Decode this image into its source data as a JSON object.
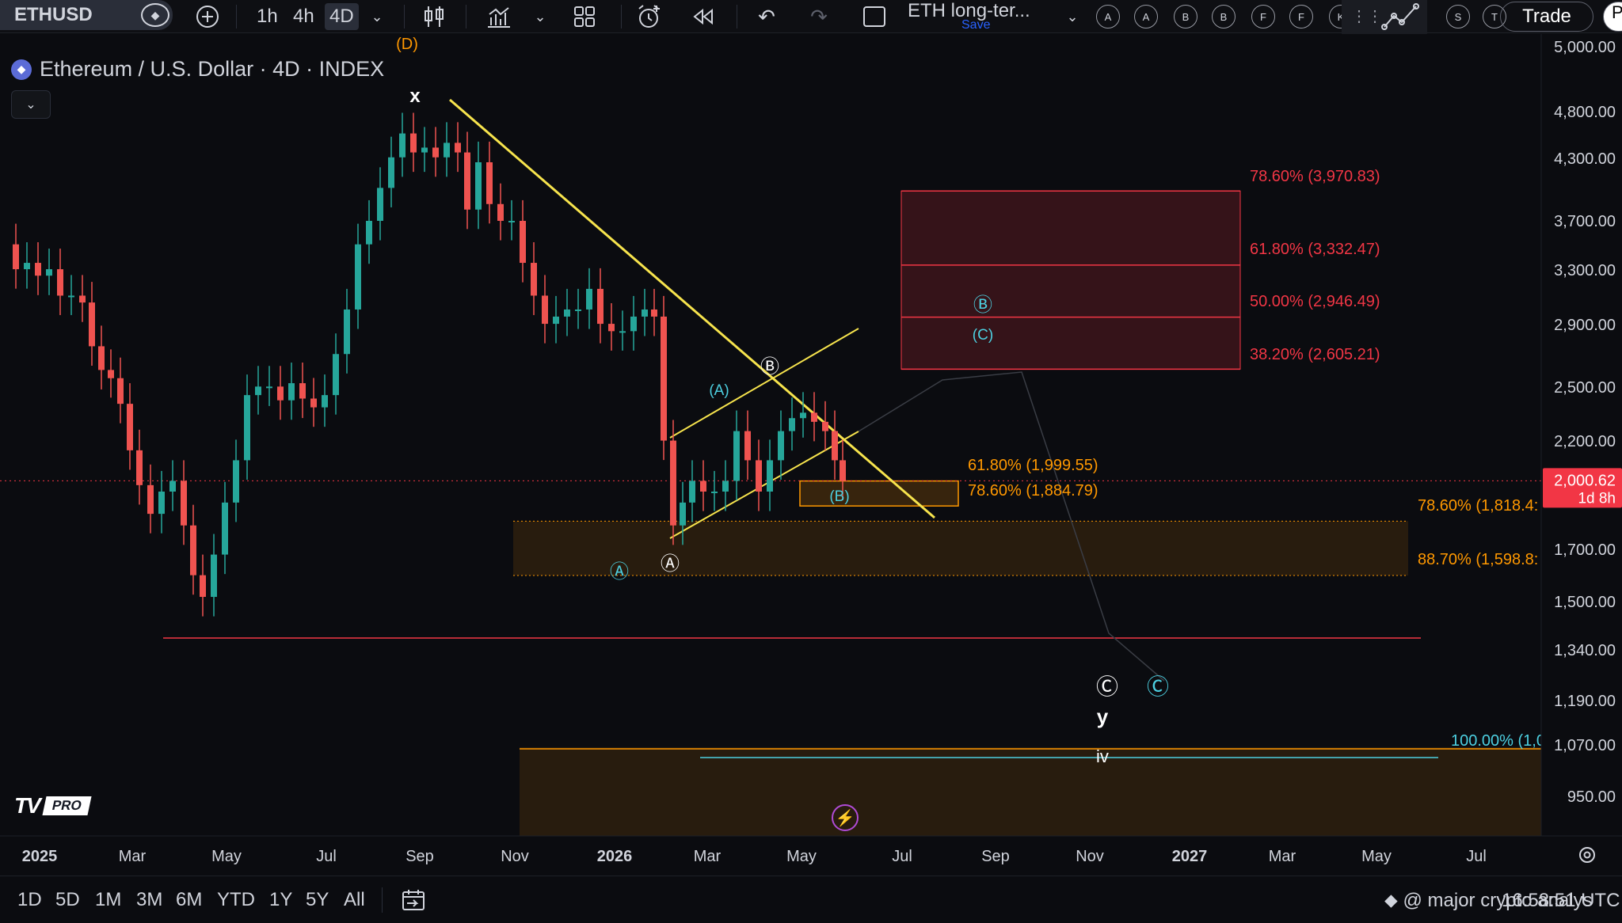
{
  "toolbar": {
    "symbol": "ETHUSD",
    "timeframes": [
      "1h",
      "4h",
      "4D"
    ],
    "active_timeframe": "4D",
    "layout_name": "ETH long-ter...",
    "layout_save": "Save",
    "alert_circles": [
      "A",
      "A",
      "B",
      "B",
      "F",
      "F",
      "K",
      "S",
      "T"
    ],
    "trade_label": "Trade",
    "trade2_label": "P"
  },
  "legend": {
    "title": "Ethereum / U.S. Dollar · 4D · INDEX",
    "collapse": "⌄"
  },
  "chart_data": {
    "type": "candlestick",
    "title": "Ethereum / U.S. Dollar · 4D · INDEX",
    "price_axis_labels": [
      "5,000.00",
      "4,800.00",
      "4,300.00",
      "3,700.00",
      "3,300.00",
      "2,900.00",
      "2,500.00",
      "2,200.00",
      "1,700.00",
      "1,500.00",
      "1,340.00",
      "1,190.00",
      "1,070.00",
      "950.00"
    ],
    "time_axis_labels": [
      "2025",
      "Mar",
      "May",
      "Jul",
      "Sep",
      "Nov",
      "2026",
      "Mar",
      "May",
      "Jul",
      "Sep",
      "Nov",
      "2027",
      "Mar",
      "May",
      "Jul"
    ],
    "last_price": "2,000.62",
    "last_price_countdown": "1d 8h",
    "price_scale": "log",
    "fib_levels_upper": [
      {
        "label": "78.60% (3,970.83)",
        "value": 3970.83
      },
      {
        "label": "61.80% (3,332.47)",
        "value": 3332.47
      },
      {
        "label": "50.00% (2,946.49)",
        "value": 2946.49
      },
      {
        "label": "38.20% (2,605.21)",
        "value": 2605.21
      }
    ],
    "fib_levels_middle": [
      {
        "label": "61.80% (1,999.55)",
        "value": 1999.55
      },
      {
        "label": "78.60% (1,884.79)",
        "value": 1884.79
      }
    ],
    "fib_levels_lower": [
      {
        "label": "78.60% (1,818.4:",
        "value": 1818.4
      },
      {
        "label": "88.70% (1,598.8:",
        "value": 1598.8
      },
      {
        "label": "100.00% (1,0",
        "value": 1070
      }
    ],
    "wave_labels": [
      "x",
      "Ⓑ",
      "(A)",
      "(B)",
      "(C)",
      "Ⓐ",
      "Ⓐ",
      "Ⓒ",
      "Ⓒ",
      "Ⓑ",
      "y",
      "iv"
    ],
    "partial_label_top": "(D)"
  },
  "bottom": {
    "ranges": [
      "1D",
      "5D",
      "1M",
      "3M",
      "6M",
      "YTD",
      "1Y",
      "5Y",
      "All"
    ],
    "status": "@ major crypto analys",
    "clock": "16:58:51 UTC"
  },
  "brand": {
    "logo_text": "TV",
    "pro": "PRO"
  }
}
